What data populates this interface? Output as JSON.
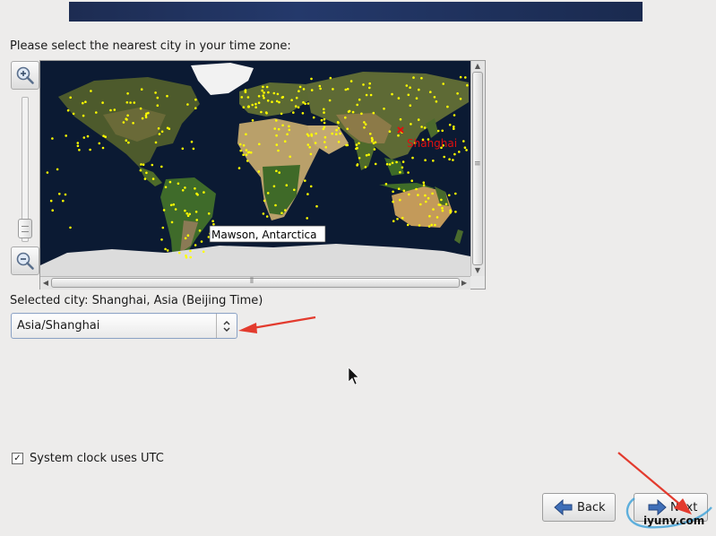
{
  "prompt": "Please select the nearest city in your time zone:",
  "map": {
    "hover_label": "Mawson, Antarctica",
    "selected_marker_label": "Shanghai"
  },
  "selected_city": "Selected city: Shanghai, Asia (Beijing Time)",
  "timezone_select": {
    "value": "Asia/Shanghai"
  },
  "utc_checkbox": {
    "label": "System clock uses UTC",
    "checked": true
  },
  "buttons": {
    "back": "Back",
    "next": "Next"
  },
  "watermark": "iyunv.com",
  "colors": {
    "ocean": "#0b1a33",
    "city_dot": "#ffff00",
    "selected_marker": "#e01010",
    "annotation_arrow": "#e33b2e"
  },
  "icons": {
    "zoom_in": "zoom-in-icon",
    "zoom_out": "zoom-out-icon",
    "back": "left-arrow-icon",
    "next": "right-arrow-icon"
  }
}
